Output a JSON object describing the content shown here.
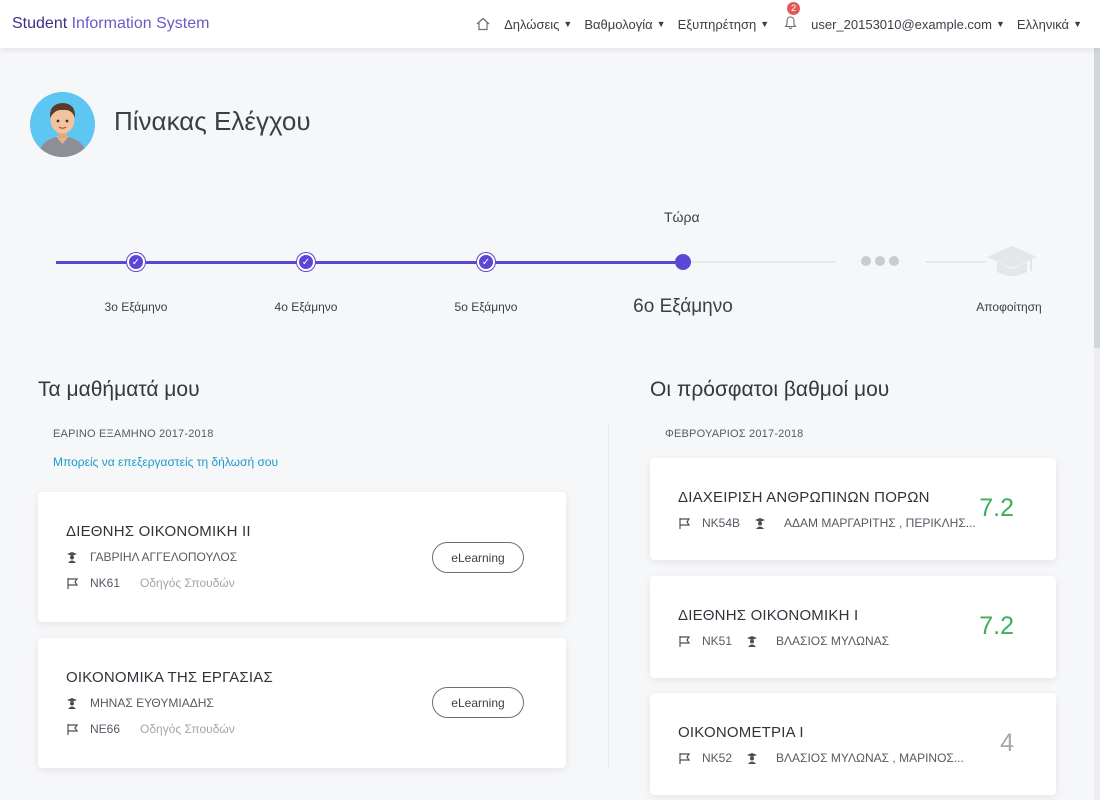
{
  "navbar": {
    "brand_part1": "Student",
    "brand_part2": "Information System",
    "menu": [
      "Δηλώσεις",
      "Βαθμολογία",
      "Εξυπηρέτηση"
    ],
    "notifications_count": "2",
    "user": "user_20153010@example.com",
    "language": "Ελληνικά"
  },
  "header": {
    "title": "Πίνακας Ελέγχου"
  },
  "timeline": {
    "now_label": "Τώρα",
    "steps": [
      "3ο  Εξάμηνο",
      "4ο  Εξάμηνο",
      "5ο  Εξάμηνο",
      "6ο Εξάμηνο",
      "Αποφοίτηση"
    ]
  },
  "courses": {
    "heading": "Τα μαθήματά μου",
    "period": "ΕΑΡΙΝΟ ΕΞΑΜΗΝΟ 2017-2018",
    "edit_link": "Μπορείς να επεξεργαστείς τη δήλωσή σου",
    "items": [
      {
        "title": "ΔΙΕΘΝΗΣ ΟΙΚΟΝΟΜΙΚΗ ΙΙ",
        "instructor": "ΓΑΒΡΙΗΛ ΑΓΓΕΛΟΠΟΥΛΟΣ",
        "code": "NK61",
        "guide": "Οδηγός Σπουδών",
        "button": "eLearning"
      },
      {
        "title": "ΟΙΚΟΝΟΜΙΚΑ ΤΗΣ ΕΡΓΑΣΙΑΣ",
        "instructor": "ΜΗΝΑΣ ΕΥΘΥΜΙΑΔΗΣ",
        "code": "NE66",
        "guide": "Οδηγός Σπουδών",
        "button": "eLearning"
      }
    ]
  },
  "grades": {
    "heading": "Οι πρόσφατοι βαθμοί μου",
    "period": "ΦΕΒΡΟΥΑΡΙΟΣ 2017-2018",
    "items": [
      {
        "title": "ΔΙΑΧΕΙΡΙΣΗ ΑΝΘΡΩΠΙΝΩΝ ΠΟΡΩΝ",
        "code": "NK54B",
        "instructors": "ΑΔΑΜ ΜΑΡΓΑΡΙΤΗΣ ,  ΠΕΡΙΚΛΗΣ...",
        "grade": "7.2"
      },
      {
        "title": "ΔΙΕΘΝΗΣ ΟΙΚΟΝΟΜΙΚΗ Ι",
        "code": "NK51",
        "instructors": "ΒΛΑΣΙΟΣ ΜΥΛΩΝΑΣ",
        "grade": "7.2"
      },
      {
        "title": "ΟΙΚΟΝΟΜΕΤΡΙΑ Ι",
        "code": "NK52",
        "instructors": "ΒΛΑΣΙΟΣ ΜΥΛΩΝΑΣ ,  ΜΑΡΙΝΟΣ...",
        "grade": "4"
      }
    ]
  },
  "colors": {
    "accent": "#5b46d6",
    "pass_grade": "#3fae5a",
    "fail_grade": "#a3a8b0",
    "link": "#1a9bc9"
  }
}
